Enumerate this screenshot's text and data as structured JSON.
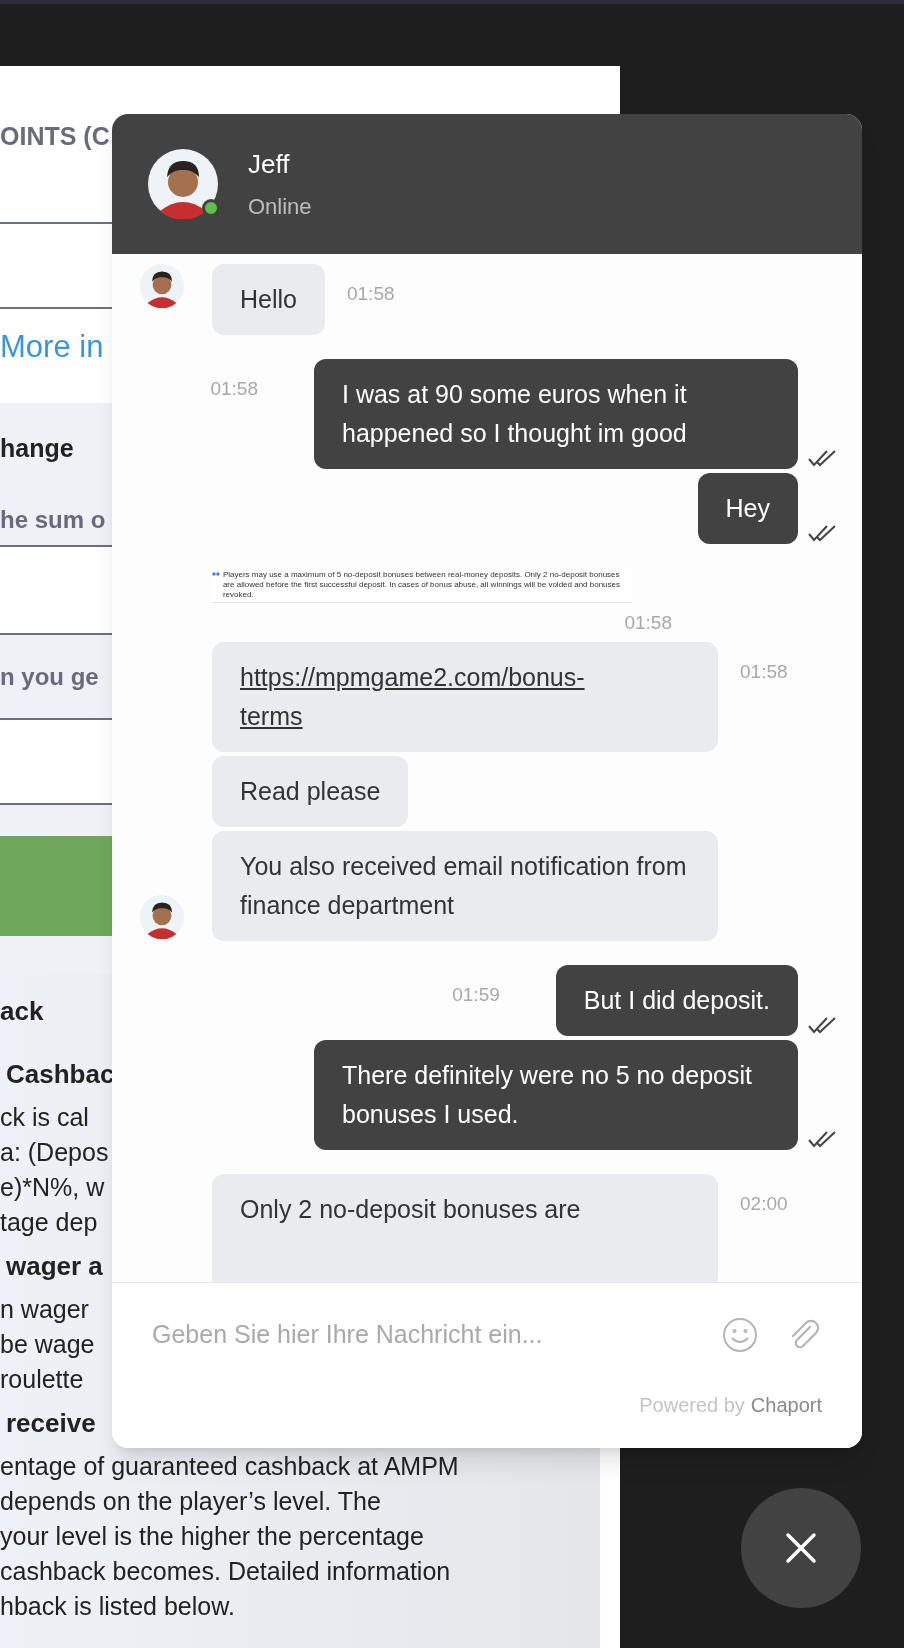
{
  "background": {
    "title": "OINTS (C",
    "link": "More in",
    "exchange": {
      "heading": "hange",
      "label_1": "he sum o",
      "label_2": "n you ge"
    },
    "cashback": {
      "heading": "ack",
      "lines": [
        {
          "kind": "subheading",
          "text": "Cashbac"
        },
        {
          "kind": "text",
          "text": "ck is cal"
        },
        {
          "kind": "text",
          "text": "a: (Depos"
        },
        {
          "kind": "text",
          "text": "e)*N%, w"
        },
        {
          "kind": "text",
          "text": "tage dep"
        },
        {
          "kind": "subheading",
          "text": "wager a"
        },
        {
          "kind": "text",
          "text": "n wager"
        },
        {
          "kind": "text",
          "text": "be wage"
        },
        {
          "kind": "text",
          "text": "roulette"
        },
        {
          "kind": "subheading",
          "text": "receive"
        },
        {
          "kind": "text",
          "text": "entage of guaranteed cashback at AMPM"
        },
        {
          "kind": "text",
          "text": "depends on the player’s level. The"
        },
        {
          "kind": "text",
          "text": "your level is the higher the percentage"
        },
        {
          "kind": "text",
          "text": "cashback becomes. Detailed information"
        },
        {
          "kind": "text",
          "text": "hback is listed below."
        }
      ]
    }
  },
  "chat": {
    "agent": {
      "name": "Jeff",
      "status": "Online",
      "online": true
    },
    "messages": [
      {
        "kind": "incoming",
        "text": "Hello",
        "time": "01:58",
        "avatar": true
      },
      {
        "kind": "outgoing",
        "text": "I was at 90 some euros when it happened so I thought im good",
        "time": "01:58",
        "read": true
      },
      {
        "kind": "outgoing",
        "text": "Hey",
        "read": true
      },
      {
        "kind": "incoming_image",
        "text": "Players may use a maximum of 5 no-deposit bonuses between real-money deposits. Only 2 no-deposit bonuses are allowed before the first successful deposit. In cases of bonus abuse, all winnings will be voided and bonuses revoked.",
        "time": "01:58"
      },
      {
        "kind": "incoming_link",
        "text": "https://mpmgame2.com/bonus-terms",
        "time": "01:58"
      },
      {
        "kind": "incoming",
        "text": "Read please"
      },
      {
        "kind": "incoming",
        "text": "You also received email notification from finance department",
        "avatar": true
      },
      {
        "kind": "outgoing",
        "text": "But I did deposit.",
        "time": "01:59",
        "read": true
      },
      {
        "kind": "outgoing",
        "text": "There definitely were no 5 no deposit bonuses I used.",
        "read": true
      },
      {
        "kind": "incoming",
        "text": "Only 2 no-deposit bonuses are",
        "time": "02:00"
      }
    ],
    "input": {
      "placeholder": "Geben Sie hier Ihre Nachricht ein..."
    },
    "powered_by": "Powered by",
    "brand": "Chaport"
  }
}
